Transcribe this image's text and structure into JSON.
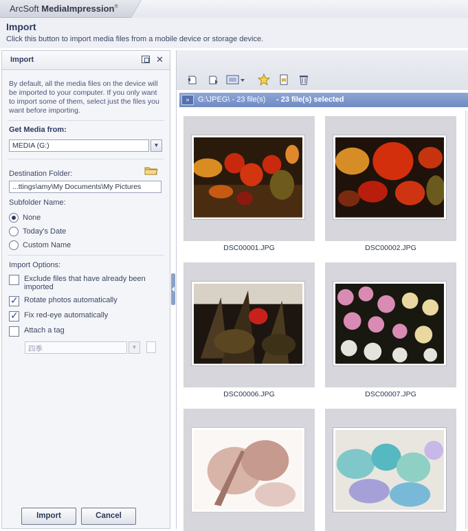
{
  "app": {
    "brand_prefix": "ArcSoft",
    "brand_name": "MediaImpression",
    "trademark": "®"
  },
  "header": {
    "title": "Import",
    "description": "Click this button to import media files from a mobile device or storage device."
  },
  "panel": {
    "title": "Import",
    "intro": "By default, all the media files on the device will be imported to your computer. If you only want to import some of them, select just the files you want before importing.",
    "get_media_label": "Get Media from:",
    "media_source": "MEDIA (G:)",
    "destination_label": "Destination Folder:",
    "destination_value": "...ttings\\amy\\My Documents\\My Pictures",
    "subfolder_label": "Subfolder Name:",
    "subfolder_options": [
      {
        "label": "None",
        "selected": true
      },
      {
        "label": "Today's Date",
        "selected": false
      },
      {
        "label": "Custom Name",
        "selected": false
      }
    ],
    "import_options_label": "Import Options:",
    "import_options": [
      {
        "label": "Exclude files that have already been imported",
        "checked": false
      },
      {
        "label": "Rotate photos automatically",
        "checked": true
      },
      {
        "label": "Fix red-eye automatically",
        "checked": true
      },
      {
        "label": "Attach a tag",
        "checked": false
      }
    ],
    "tag_value": "四季",
    "import_button": "Import",
    "cancel_button": "Cancel"
  },
  "browser": {
    "path": "G:\\JPEG\\ - 23 file(s)",
    "selection": "- 23 file(s) selected",
    "thumbnails": [
      {
        "name": "DSC00001.JPG",
        "theme": "fruit-warm"
      },
      {
        "name": "DSC00002.JPG",
        "theme": "fruit-warm"
      },
      {
        "name": "DSC00006.JPG",
        "theme": "plant-dark"
      },
      {
        "name": "DSC00007.JPG",
        "theme": "roses"
      },
      {
        "name": "",
        "theme": "leaf-inverted"
      },
      {
        "name": "",
        "theme": "cyan-inverted"
      }
    ]
  },
  "colors": {
    "accent": "#7a93c9",
    "panel_bg": "#f4f5f9",
    "thumb_bg": "#d6d6dc"
  }
}
